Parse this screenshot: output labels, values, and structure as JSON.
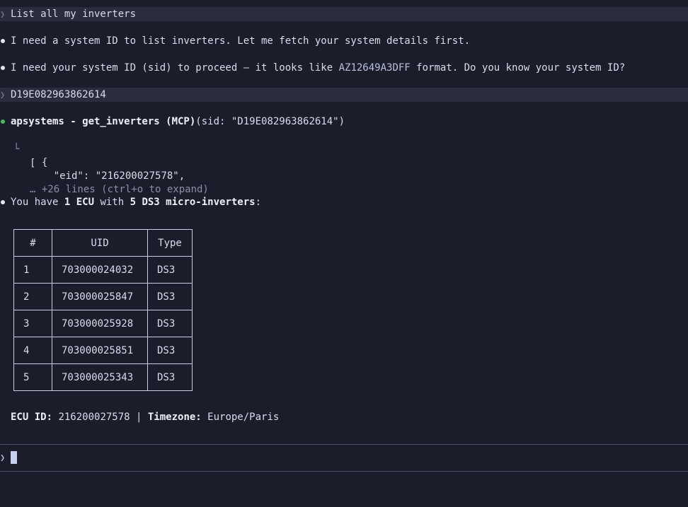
{
  "conversation": {
    "user_prompt_1": "List all my inverters",
    "assistant_msg_1": "I need a system ID to list inverters. Let me fetch your system details first.",
    "assistant_msg_2_pre": "I need your system ID (sid) to proceed — it looks like ",
    "assistant_msg_2_code": "AZ12649A3DFF",
    "assistant_msg_2_post": " format. Do you know your system ID?",
    "user_prompt_2": "D19E082963862614",
    "tool_call_name": "apsystems - get_inverters (MCP)",
    "tool_call_args": "(sid: \"D19E082963862614\")",
    "tool_output_lines": [
      "[",
      "  {",
      "    \"eid\": \"216200027578\","
    ],
    "tool_output_more": "… +26 lines (ctrl+o to expand)",
    "summary_pre": "You have ",
    "summary_b1": "1 ECU",
    "summary_mid": " with ",
    "summary_b2": "5 DS3 micro-inverters",
    "summary_post": ":"
  },
  "table": {
    "headers": [
      "#",
      "UID",
      "Type"
    ],
    "rows": [
      [
        "1",
        "703000024032",
        "DS3"
      ],
      [
        "2",
        "703000025847",
        "DS3"
      ],
      [
        "3",
        "703000025928",
        "DS3"
      ],
      [
        "4",
        "703000025851",
        "DS3"
      ],
      [
        "5",
        "703000025343",
        "DS3"
      ]
    ]
  },
  "footer": {
    "ecu_label": "ECU ID:",
    "ecu_value": " 216200027578 | ",
    "tz_label": "Timezone:",
    "tz_value": " Europe/Paris"
  },
  "input": {
    "prompt_char": "❯",
    "value": ""
  },
  "icons": {
    "prompt": "chevron-right-icon",
    "bullet": "bullet-dot-icon"
  },
  "colors": {
    "background": "#1b1e2a",
    "prompt_bar": "#292d3d",
    "tool_dot": "#3fbf5a",
    "cursor": "#c8cdf0"
  }
}
